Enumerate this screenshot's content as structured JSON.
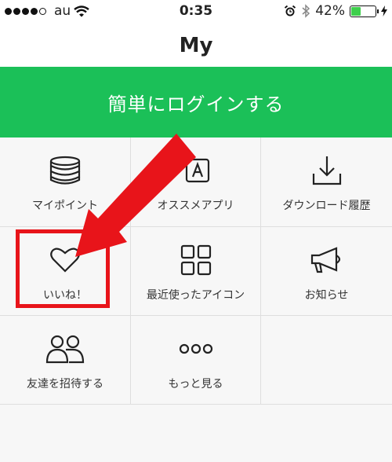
{
  "status_bar": {
    "carrier": "au",
    "time": "0:35",
    "battery_percent": "42%",
    "battery_level": 0.42,
    "icons": [
      "signal-dots-icon",
      "wifi-icon",
      "alarm-icon",
      "bluetooth-icon",
      "battery-icon",
      "charging-icon"
    ]
  },
  "nav": {
    "title": "My"
  },
  "login": {
    "label": "簡単にログインする",
    "color": "#1bc058"
  },
  "menu": {
    "items": [
      {
        "label": "マイポイント",
        "icon": "coin-stack-icon"
      },
      {
        "label": "オススメアプリ",
        "icon": "app-store-icon"
      },
      {
        "label": "ダウンロード履歴",
        "icon": "download-icon"
      },
      {
        "label": "いいね！",
        "icon": "heart-icon"
      },
      {
        "label": "最近使ったアイコン",
        "icon": "grid-icon"
      },
      {
        "label": "お知らせ",
        "icon": "megaphone-icon"
      },
      {
        "label": "友達を招待する",
        "icon": "people-icon"
      },
      {
        "label": "もっと見る",
        "icon": "more-dots-icon"
      }
    ]
  },
  "annotation": {
    "color": "#e8141a"
  }
}
